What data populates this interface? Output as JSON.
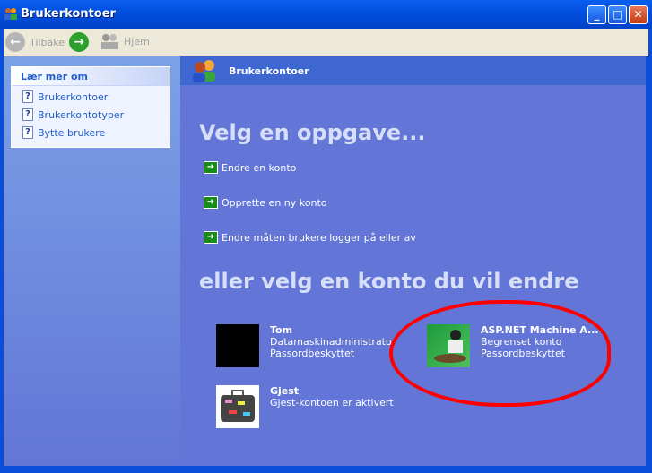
{
  "window": {
    "title": "Brukerkontoer",
    "min": "_",
    "max": "□",
    "close": "✕"
  },
  "toolbar": {
    "back": "Tilbake",
    "home": "Hjem"
  },
  "sidebar": {
    "heading": "Lær mer om",
    "items": [
      {
        "label": "Brukerkontoer"
      },
      {
        "label": "Brukerkontotyper"
      },
      {
        "label": "Bytte brukere"
      }
    ]
  },
  "main": {
    "header": "Brukerkontoer",
    "pick_task": "Velg en oppgave...",
    "tasks": [
      {
        "label": "Endre en konto"
      },
      {
        "label": "Opprette en ny konto"
      },
      {
        "label": "Endre måten brukere logger på eller av"
      }
    ],
    "pick_account": "eller velg en konto du vil endre",
    "accounts": [
      {
        "name": "Tom",
        "line1": "Datamaskinadministrator",
        "line2": "Passordbeskyttet"
      },
      {
        "name": "ASP.NET Machine A...",
        "line1": "Begrenset konto",
        "line2": "Passordbeskyttet"
      },
      {
        "name": "Gjest",
        "line1": "Gjest-kontoen er aktivert",
        "line2": ""
      }
    ]
  }
}
